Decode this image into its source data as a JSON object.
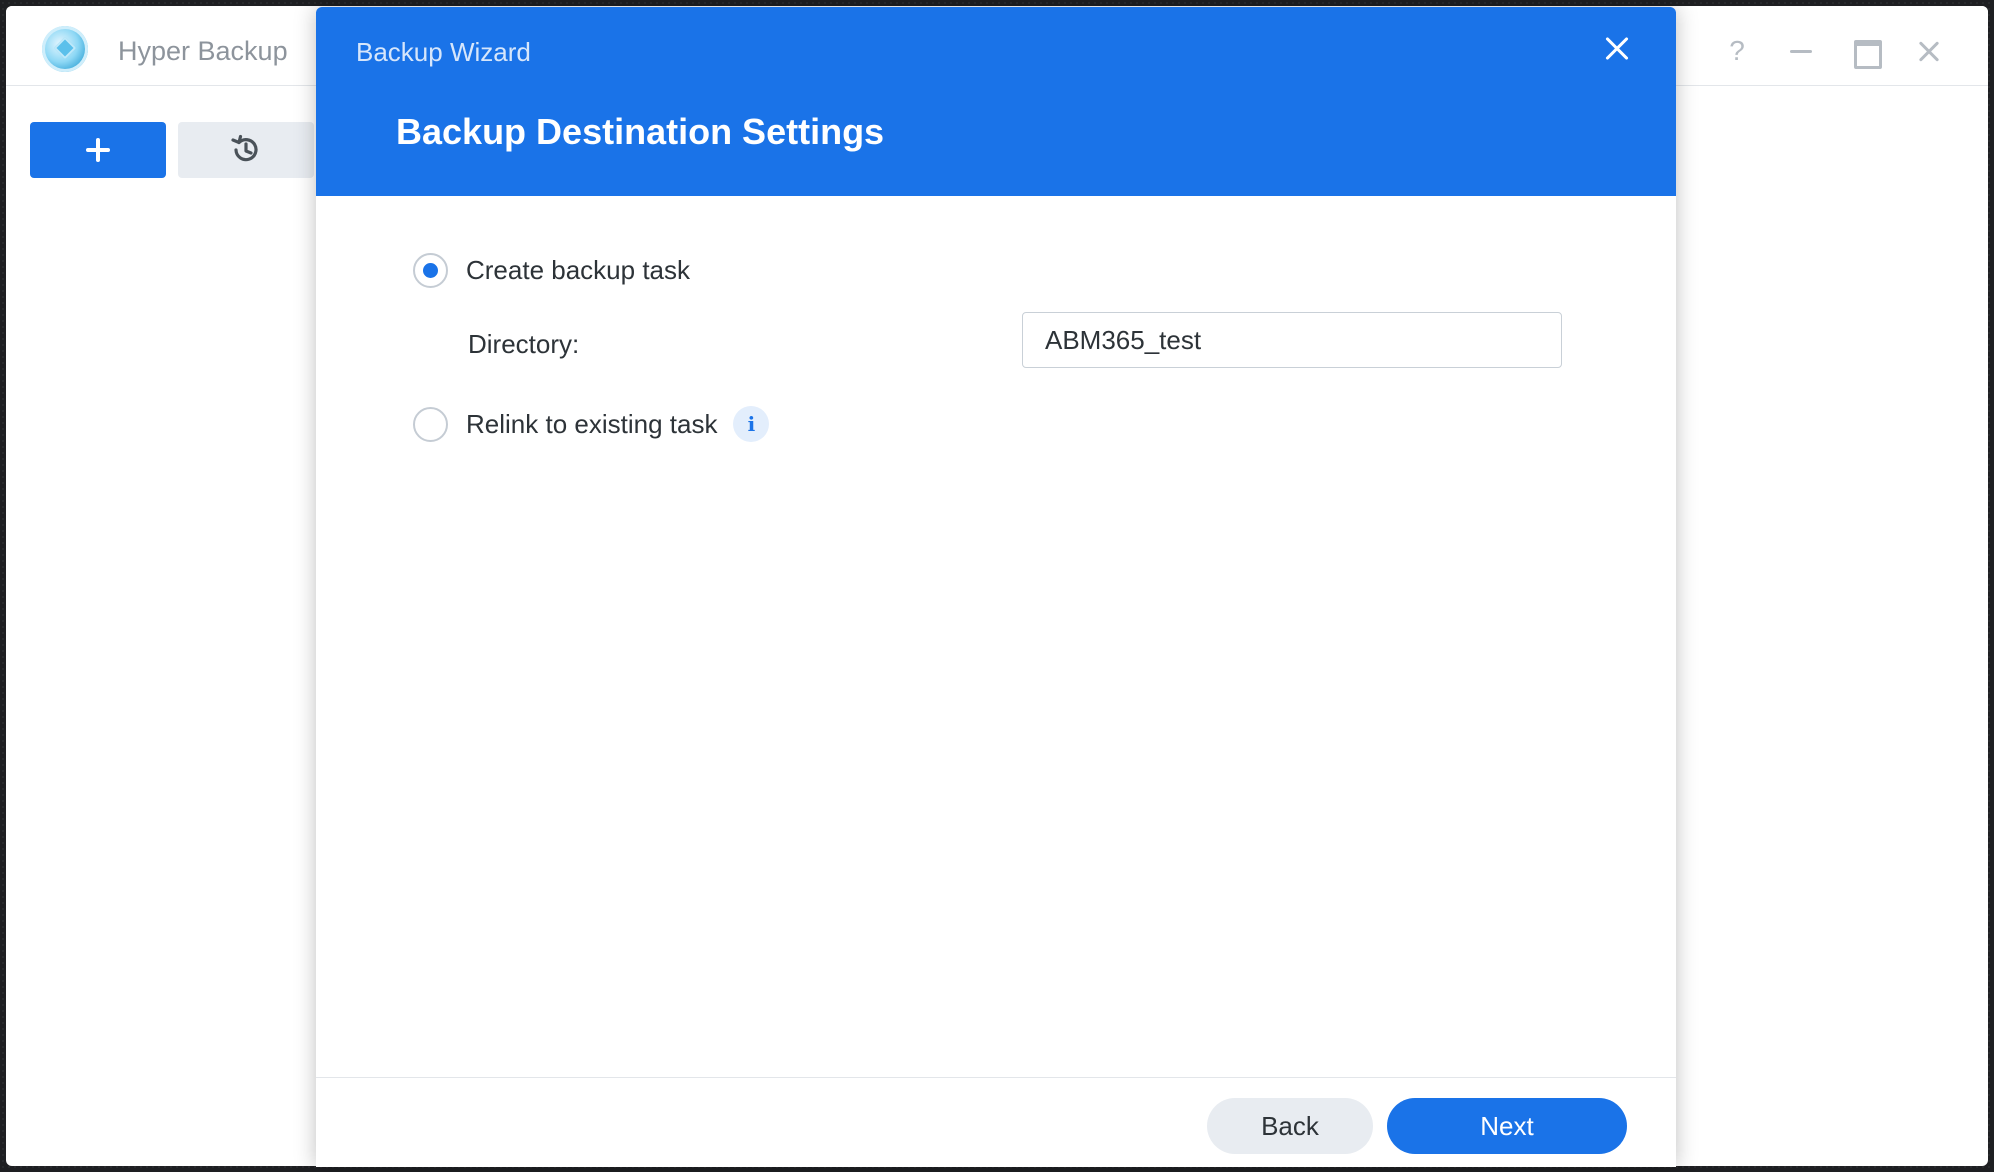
{
  "app": {
    "title": "Hyper Backup",
    "help_glyph": "?"
  },
  "dialog": {
    "title": "Backup Wizard",
    "step_title": "Backup Destination Settings",
    "options": [
      {
        "label": "Create backup task",
        "selected": true
      },
      {
        "label": "Relink to existing task",
        "selected": false
      }
    ],
    "directory": {
      "label": "Directory:",
      "value": "ABM365_test"
    },
    "info_glyph": "i",
    "footer": {
      "back_label": "Back",
      "next_label": "Next"
    }
  },
  "colors": {
    "accent": "#1a73e8",
    "secondary_button": "#e8ecf1"
  }
}
